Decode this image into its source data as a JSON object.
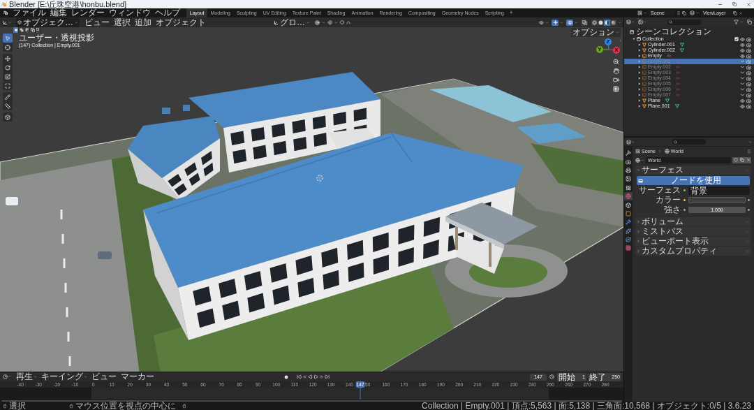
{
  "window": {
    "title": "Blender [E:\\丘珠空港\\honbu.blend]"
  },
  "top_bar": {
    "menus": [
      "ファイル",
      "編集",
      "レンダー",
      "ウィンドウ",
      "ヘルプ"
    ],
    "workspaces": [
      {
        "label": "Layout",
        "selected": true
      },
      {
        "label": "Modeling",
        "selected": false
      },
      {
        "label": "Sculpting",
        "selected": false
      },
      {
        "label": "UV Editing",
        "selected": false
      },
      {
        "label": "Texture Paint",
        "selected": false
      },
      {
        "label": "Shading",
        "selected": false
      },
      {
        "label": "Animation",
        "selected": false
      },
      {
        "label": "Rendering",
        "selected": false
      },
      {
        "label": "Compositing",
        "selected": false
      },
      {
        "label": "Geometry Nodes",
        "selected": false
      },
      {
        "label": "Scripting",
        "selected": false
      }
    ],
    "add_workspace": "+",
    "scene": "Scene",
    "view_layer": "ViewLayer"
  },
  "viewport": {
    "mode": "オブジェク…",
    "menus": [
      "ビュー",
      "選択",
      "追加",
      "オブジェクト"
    ],
    "orientation": "グロ…",
    "toggles": [
      {
        "kind": "gizmo",
        "on": true
      },
      {
        "kind": "overlay",
        "on": true
      },
      {
        "kind": "xray",
        "on": false
      }
    ],
    "shading": [
      {
        "kind": "wireframe",
        "selected": false
      },
      {
        "kind": "solid",
        "selected": false
      },
      {
        "kind": "material",
        "selected": true
      },
      {
        "kind": "rendered",
        "selected": false
      }
    ],
    "options": "オプション",
    "select_modes": [
      {
        "kind": "set",
        "selected": true
      },
      {
        "kind": "extend",
        "selected": false
      },
      {
        "kind": "subtract",
        "selected": false
      },
      {
        "kind": "invert",
        "selected": false
      },
      {
        "kind": "intersect",
        "selected": false
      }
    ],
    "view_name": "ユーザー・透視投影",
    "context": "(147) Collection | Empty.001",
    "tools": [
      {
        "kind": "select",
        "selected": true
      },
      {
        "kind": "cursor",
        "selected": false
      },
      {
        "kind": "move",
        "selected": false
      },
      {
        "kind": "rotate",
        "selected": false
      },
      {
        "kind": "scale",
        "selected": false
      },
      {
        "kind": "transform",
        "selected": false
      },
      {
        "kind": "annotate",
        "selected": false
      },
      {
        "kind": "measure",
        "selected": false
      },
      {
        "kind": "add_cube",
        "selected": false
      }
    ],
    "gizmo_axes": [
      {
        "label": "Z",
        "color": "#2f86ea"
      },
      {
        "label": "Y",
        "color": "#6ba51f"
      },
      {
        "label": "X",
        "color": "#e0344f"
      }
    ]
  },
  "outliner": {
    "title": "シーンコレクション",
    "children": [
      {
        "name": "Collection",
        "kind": "collection",
        "expanded": true,
        "checked": true,
        "selected": false,
        "visible": true,
        "children": [
          {
            "name": "Cylinder.001",
            "kind": "mesh",
            "expanded": false,
            "selected": false,
            "visible": true
          },
          {
            "name": "Cylinder.002",
            "kind": "mesh",
            "expanded": false,
            "selected": false,
            "visible": true
          },
          {
            "name": "Empty",
            "kind": "empty",
            "expanded": false,
            "selected": false,
            "visible": true
          },
          {
            "name": "Empty.001",
            "kind": "empty",
            "expanded": false,
            "selected": true,
            "visible": false
          },
          {
            "name": "Empty.002",
            "kind": "empty",
            "expanded": false,
            "selected": false,
            "visible": false
          },
          {
            "name": "Empty.003",
            "kind": "empty",
            "expanded": false,
            "selected": false,
            "visible": false
          },
          {
            "name": "Empty.004",
            "kind": "empty",
            "expanded": false,
            "selected": false,
            "visible": false
          },
          {
            "name": "Empty.005",
            "kind": "empty",
            "expanded": false,
            "selected": false,
            "visible": false
          },
          {
            "name": "Empty.006",
            "kind": "empty",
            "expanded": false,
            "selected": false,
            "visible": false
          },
          {
            "name": "Empty.007",
            "kind": "empty",
            "expanded": false,
            "selected": false,
            "visible": false
          },
          {
            "name": "Plane",
            "kind": "mesh",
            "expanded": false,
            "selected": false,
            "visible": true
          },
          {
            "name": "Plane.001",
            "kind": "mesh",
            "expanded": false,
            "selected": false,
            "visible": true
          }
        ]
      }
    ]
  },
  "properties": {
    "tabs": [
      {
        "kind": "tool",
        "selected": false
      },
      {
        "kind": "render",
        "selected": false
      },
      {
        "kind": "output",
        "selected": false
      },
      {
        "kind": "view_layer",
        "selected": false
      },
      {
        "kind": "scene",
        "selected": false
      },
      {
        "kind": "world",
        "selected": true
      },
      {
        "kind": "collection",
        "selected": false
      },
      {
        "kind": "object",
        "selected": false
      },
      {
        "kind": "modifiers",
        "selected": false
      },
      {
        "kind": "particles",
        "selected": false
      },
      {
        "kind": "physics",
        "selected": false
      },
      {
        "kind": "texture",
        "selected": false
      }
    ],
    "breadcrumb": [
      "Scene",
      "World"
    ],
    "datablock": "World",
    "panels": [
      {
        "title": "サーフェス",
        "expanded": true,
        "button": "ノードを使用",
        "fields": [
          {
            "kind": "shader",
            "label": "サーフェス",
            "value": "背景"
          },
          {
            "kind": "color",
            "label": "カラー",
            "color": "#3f3f3f"
          },
          {
            "kind": "number",
            "label": "強さ",
            "value": "1.000"
          }
        ]
      },
      {
        "title": "ボリューム",
        "expanded": false
      },
      {
        "title": "ミストパス",
        "expanded": false
      },
      {
        "title": "ビューポート表示",
        "expanded": false
      },
      {
        "title": "カスタムプロパティ",
        "expanded": false
      }
    ]
  },
  "timeline": {
    "menus": [
      {
        "label": "再生",
        "kind": "dropdown"
      },
      {
        "label": "キーイング",
        "kind": "dropdown"
      },
      {
        "label": "ビュー",
        "kind": "menu"
      },
      {
        "label": "マーカー",
        "kind": "menu"
      }
    ],
    "current_frame": "147",
    "start": {
      "label": "開始",
      "value": "1"
    },
    "end": {
      "label": "終了",
      "value": "250"
    },
    "ruler": [
      "-40",
      "-30",
      "-20",
      "-10",
      "0",
      "10",
      "20",
      "30",
      "40",
      "50",
      "60",
      "70",
      "80",
      "90",
      "100",
      "110",
      "120",
      "130",
      "140",
      "50",
      "160",
      "170",
      "180",
      "190",
      "200",
      "210",
      "220",
      "230",
      "240",
      "250",
      "260",
      "270",
      "280"
    ],
    "playhead": {
      "label": "147",
      "level": 0.578
    }
  },
  "status_bar": {
    "hints": [
      {
        "kind": "left",
        "text": "選択"
      },
      {
        "kind": "middle",
        "text": "マウス位置を視点の中心に"
      },
      {
        "kind": "right"
      }
    ],
    "stats": "Collection | Empty.001 | 頂点:5,563 | 面:5,138 | 三角面:10,568 | オブジェクト:0/5 | 3.6.23"
  }
}
